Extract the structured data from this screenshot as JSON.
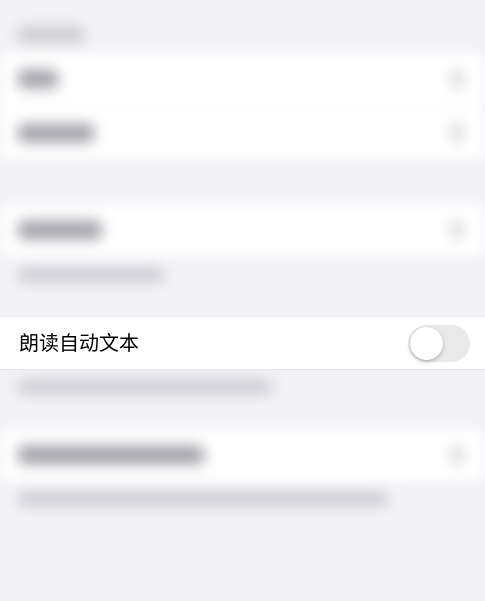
{
  "settings": {
    "speak_auto_text": {
      "label": "朗读自动文本",
      "toggle_on": false
    }
  },
  "colors": {
    "background": "#f2f2f7",
    "cell": "#ffffff",
    "toggle_off_track": "#e9e9ea",
    "label": "#000000"
  }
}
